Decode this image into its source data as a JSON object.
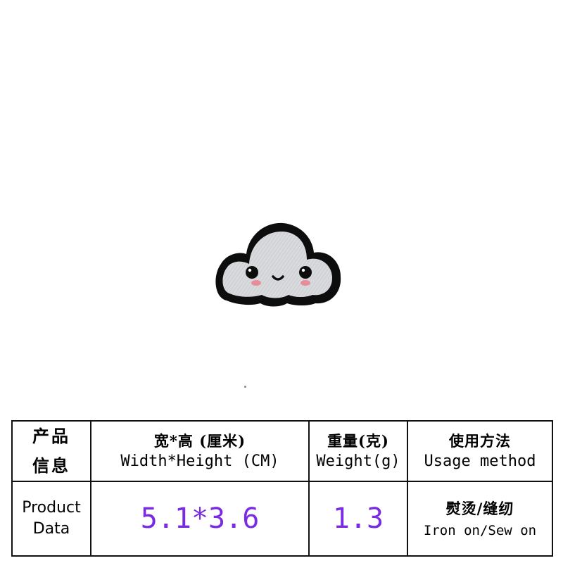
{
  "image": {
    "icon": "cloud-face-patch-icon",
    "colors": {
      "cloud_fill": "#d8dadd",
      "outline": "#0d0d0d",
      "cheek": "#e88c9a"
    }
  },
  "table": {
    "row_header": {
      "cn_line1": "产品",
      "cn_line2": "信息",
      "en_line1": "Product",
      "en_line2": "Data"
    },
    "columns": [
      {
        "cn": "宽*高 (厘米)",
        "en": "Width*Height (CM)",
        "value": "5.1*3.6"
      },
      {
        "cn": "重量(克)",
        "en": "Weight(g)",
        "value": "1.3"
      },
      {
        "cn": "使用方法",
        "en": "Usage method",
        "value_cn": "熨烫/缝纫",
        "value_en": "Iron on/Sew on"
      }
    ],
    "value_color": "#7a2be2"
  }
}
